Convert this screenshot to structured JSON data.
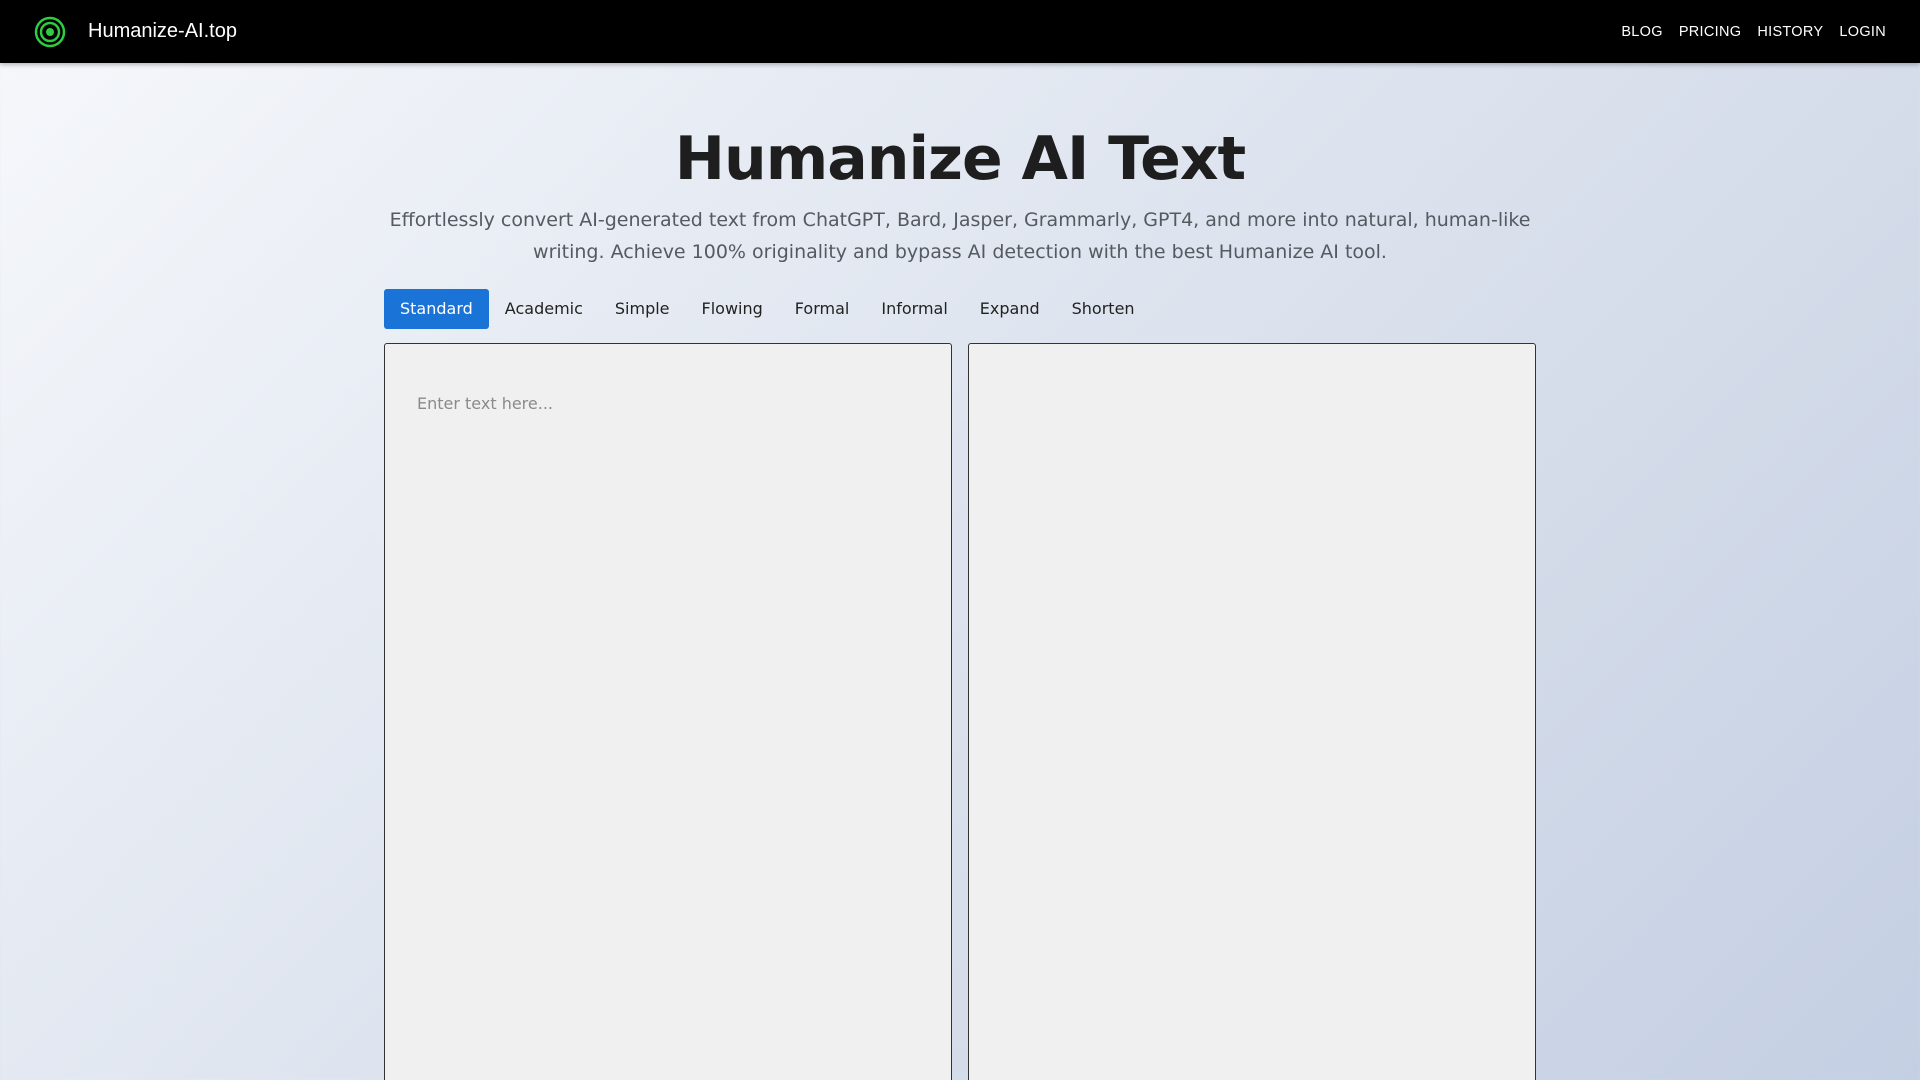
{
  "nav": {
    "brand": "Humanize-AI.top",
    "links": [
      "BLOG",
      "PRICING",
      "HISTORY",
      "LOGIN"
    ]
  },
  "hero": {
    "title": "Humanize AI Text",
    "subtitle": "Effortlessly convert AI-generated text from ChatGPT, Bard, Jasper, Grammarly, GPT4, and more into natural, human-like writing. Achieve 100% originality and bypass AI detection with the best Humanize AI tool."
  },
  "modes": {
    "active": "Standard",
    "items": [
      "Standard",
      "Academic",
      "Simple",
      "Flowing",
      "Formal",
      "Informal",
      "Expand",
      "Shorten"
    ]
  },
  "editor": {
    "input_placeholder": "Enter text here...",
    "input_value": "",
    "output_value": ""
  },
  "colors": {
    "navbar_bg": "#000000",
    "accent": "#1a73d6",
    "logo_green": "#2ecc40",
    "pane_bg": "#f0f0f0"
  },
  "icons": {
    "logo": "concentric-circles-icon"
  }
}
